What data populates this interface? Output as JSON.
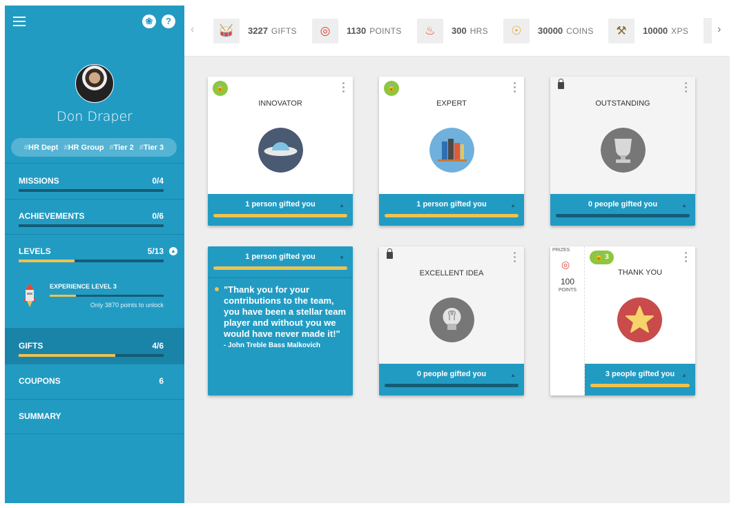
{
  "user": {
    "name": "Don Draper",
    "tags": [
      "HR Dept",
      "HR Group",
      "Tier 2",
      "Tier 3"
    ]
  },
  "sidebar": {
    "sections": [
      {
        "label": "MISSIONS",
        "count": "0/4",
        "progress": 0
      },
      {
        "label": "ACHIEVEMENTS",
        "count": "0/6",
        "progress": 0
      },
      {
        "label": "LEVELS",
        "count": "5/13",
        "progress": 0.385
      },
      {
        "label": "GIFTS",
        "count": "4/6",
        "progress": 0.667
      },
      {
        "label": "COUPONS",
        "count": "6"
      },
      {
        "label": "SUMMARY"
      }
    ],
    "level": {
      "title": "EXPERIENCE LEVEL 3",
      "note": "Only 3870 points to unlock",
      "progress": 0.23
    }
  },
  "stats": [
    {
      "icon": "drum-icon",
      "value": "3227",
      "label": "GIFTS"
    },
    {
      "icon": "target-icon",
      "value": "1130",
      "label": "POINTS"
    },
    {
      "icon": "fire-icon",
      "value": "300",
      "label": "HRS"
    },
    {
      "icon": "medal-icon",
      "value": "30000",
      "label": "COINS"
    },
    {
      "icon": "tools-icon",
      "value": "10000",
      "label": "XPS"
    }
  ],
  "cards": [
    {
      "title": "INNOVATOR",
      "footer": "1 person gifted you",
      "progress": 1,
      "status": "unlocked",
      "icon": "ufo-icon"
    },
    {
      "title": "EXPERT",
      "footer": "1 person gifted you",
      "progress": 1,
      "status": "unlocked",
      "icon": "books-icon"
    },
    {
      "title": "OUTSTANDING",
      "footer": "0 people gifted you",
      "progress": 0,
      "status": "locked",
      "icon": "trophy-icon"
    },
    {
      "footer": "1 person gifted you",
      "progress": 1,
      "quote": "\"Thank you for your contributions to the team, you have been a stellar team player and without you we would have never made it!\"",
      "author": "- John Treble Bass Malkovich"
    },
    {
      "title": "EXCELLENT IDEA",
      "footer": "0 people gifted you",
      "progress": 0,
      "status": "locked",
      "icon": "lightbulb-icon"
    },
    {
      "title": "THANK YOU",
      "footer": "3 people gifted you",
      "progress": 1,
      "status": "unlocked",
      "badge_count": "3",
      "icon": "star-icon",
      "prize": {
        "label": "PRIZES",
        "value": "100",
        "unit": "POINTS"
      }
    }
  ],
  "colors": {
    "primary": "#229bc3",
    "dark": "#155b76",
    "accent": "#f0c24d",
    "badge": "#8dc63f"
  }
}
